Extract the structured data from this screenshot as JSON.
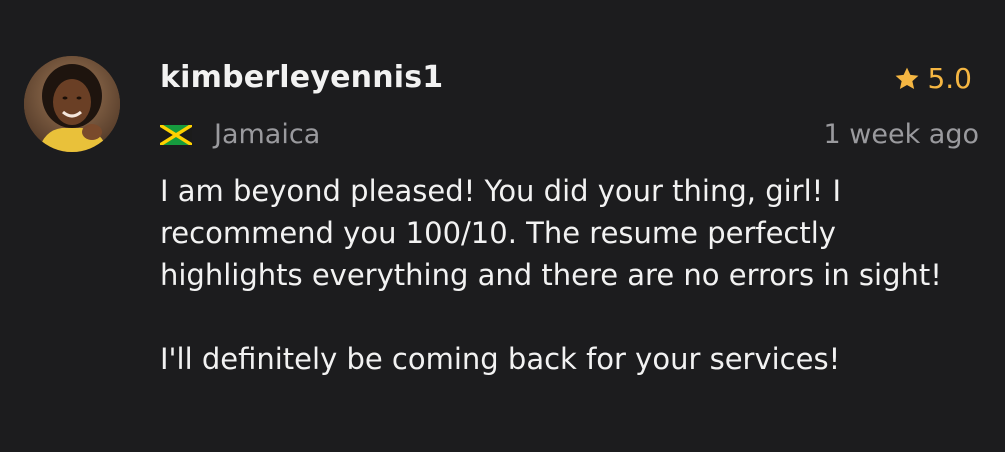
{
  "review": {
    "username": "kimberleyennis1",
    "rating": "5.0",
    "country": "Jamaica",
    "timestamp": "1 week ago",
    "paragraphs": [
      "I am beyond pleased! You did your thing, girl! I\nrecommend you 100/10. The resume perfectly\nhighlights everything and there are no errors in sight!",
      "I'll definitely be coming back for your services!"
    ]
  },
  "colors": {
    "background": "#1c1c1e",
    "star": "#f5b642",
    "muted_text": "#9a9a9e",
    "primary_text": "#f2f2f2"
  },
  "icons": {
    "avatar": "user-avatar-photo",
    "star": "star-icon",
    "flag": "jamaica-flag-icon"
  }
}
